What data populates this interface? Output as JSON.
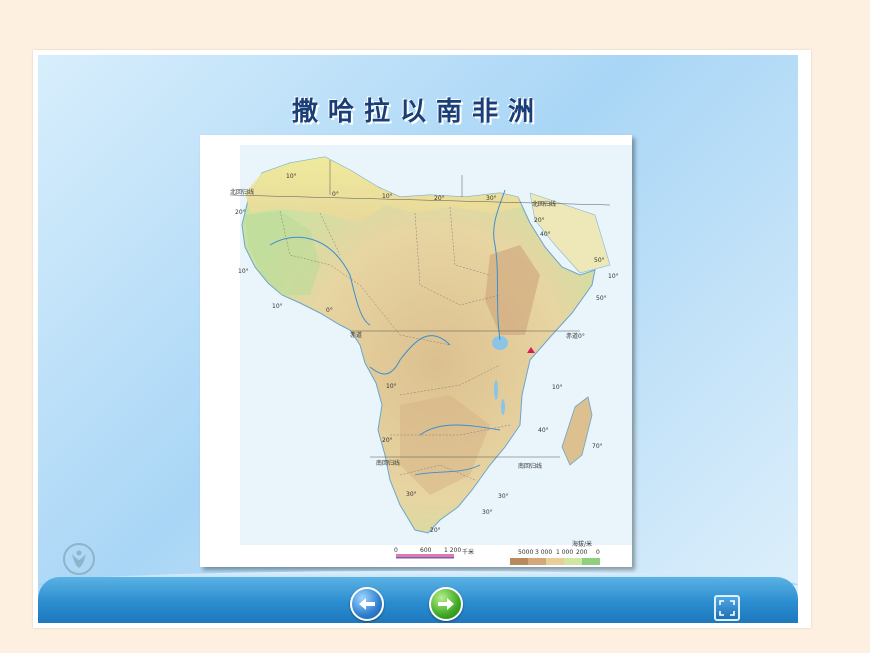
{
  "slide": {
    "title": "撒哈拉以南非洲"
  },
  "map": {
    "labels": {
      "tropic_cancer_left": "北回归线",
      "tropic_cancer_right": "北回归线",
      "equator_left": "赤道",
      "equator_right": "赤道0°",
      "tropic_capricorn_left": "南回归线",
      "tropic_capricorn_right": "南回归线",
      "lat_10_north_left": "10°",
      "lat_20_north_left": "20°",
      "lat_10_top": "10°",
      "lon_0_top": "0°",
      "lon_10_top": "10°",
      "lon_20_top": "20°",
      "lon_30_top": "30°",
      "lat_20_right": "20°",
      "lon_40_right": "40°",
      "lon_50_right_top": "50°",
      "lat_10_right_top": "10°",
      "lon_50_right": "50°",
      "lon_10_left_bottom": "10°",
      "lon_0_bottom": "0°",
      "lat_10_south_left": "10°",
      "lat_10_south_right": "10°",
      "lat_20_south_left": "20°",
      "lon_40_south": "40°",
      "lon_70_south": "70°",
      "lat_30_south_left": "30°",
      "lat_30_south_right": "30°",
      "lon_30_bottom": "30°",
      "lat_20_bottom": "20°"
    },
    "scale": {
      "zero": "0",
      "mid": "600",
      "max": "1 200",
      "unit": "千米"
    },
    "legend": {
      "title": "海拔/米",
      "values": [
        "5000",
        "3 000",
        "1 000",
        "200",
        "0"
      ],
      "colors": [
        "#b98a5c",
        "#d4a77a",
        "#e8cf98",
        "#cfe6a5",
        "#8fcf7f"
      ]
    }
  },
  "navigation": {
    "prev_icon": "arrow-left-icon",
    "next_icon": "arrow-right-icon",
    "fullscreen_icon": "fullscreen-icon"
  }
}
